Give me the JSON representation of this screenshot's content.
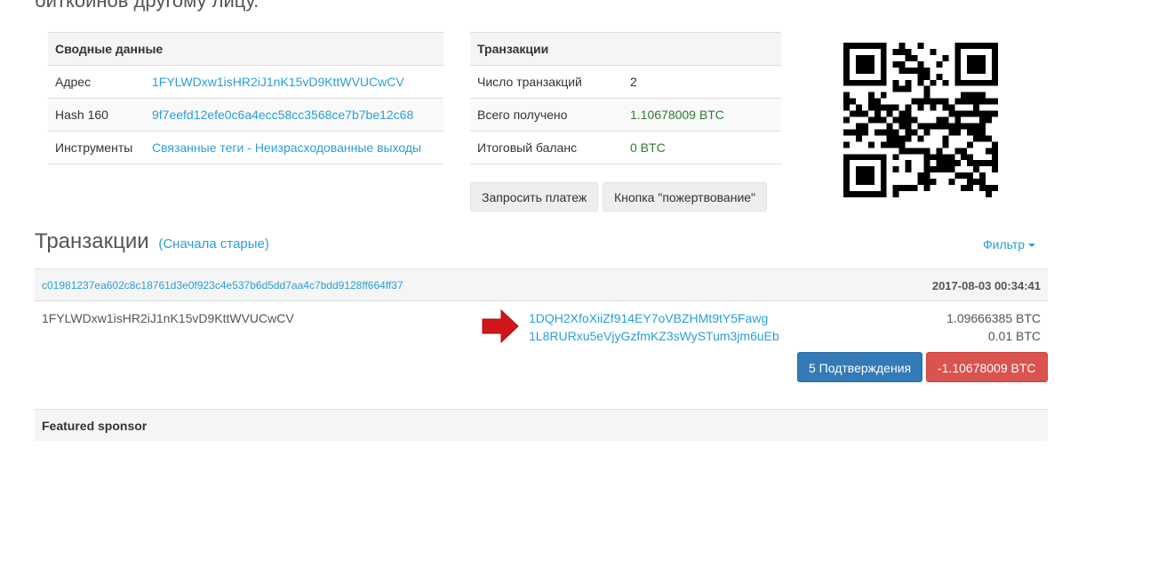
{
  "page": {
    "heading_fragment": "биткойнов другому лицу."
  },
  "summary": {
    "title": "Сводные данные",
    "rows": [
      {
        "label": "Адрес",
        "value": "1FYLWDxw1isHR2iJ1nK15vD9KttWVUCwCV"
      },
      {
        "label": "Hash 160",
        "value": "9f7eefd12efe0c6a4ecc58cc3568ce7b7be12c68"
      },
      {
        "label": "Инструменты",
        "link1": "Связанные теги",
        "separator": " - ",
        "link2": "Неизрасходованные выходы"
      }
    ]
  },
  "tx_summary": {
    "title": "Транзакции",
    "rows": [
      {
        "label": "Число транзакций",
        "value": "2"
      },
      {
        "label": "Всего получено",
        "value": "1.10678009 BTC"
      },
      {
        "label": "Итоговый баланс",
        "value": "0 BTC"
      }
    ],
    "request_payment_label": "Запросить платеж",
    "donate_button_label": "Кнопка \"пожертвование\""
  },
  "transactions": {
    "title": "Транзакции",
    "sort_label": "(Сначала старые)",
    "filter_label": "Фильтр",
    "items": [
      {
        "hash": "c01981237ea602c8c18761d3e0f923c4e537b6d5dd7aa4c7bdd9128ff664ff37",
        "date": "2017-08-03 00:34:41",
        "from": "1FYLWDxw1isHR2iJ1nK15vD9KttWVUCwCV",
        "outputs": [
          {
            "address": "1DQH2XfoXiiZf914EY7oVBZHMt9tY5Fawg",
            "amount": "1.09666385 BTC"
          },
          {
            "address": "1L8RURxu5eVjyGzfmKZ3sWySTum3jm6uEb",
            "amount": "0.01 BTC"
          }
        ],
        "confirmations_label": "5 Подтверждения",
        "net_amount": "-1.10678009 BTC"
      }
    ]
  },
  "sponsor": {
    "title": "Featured sponsor"
  },
  "colors": {
    "link": "#2a9fd6",
    "positive": "#2f7c2f",
    "confirm": "#337ab7",
    "negative": "#d9534f"
  },
  "icons": {
    "arrow": "red-right-arrow-icon",
    "qr": "qr-code"
  }
}
